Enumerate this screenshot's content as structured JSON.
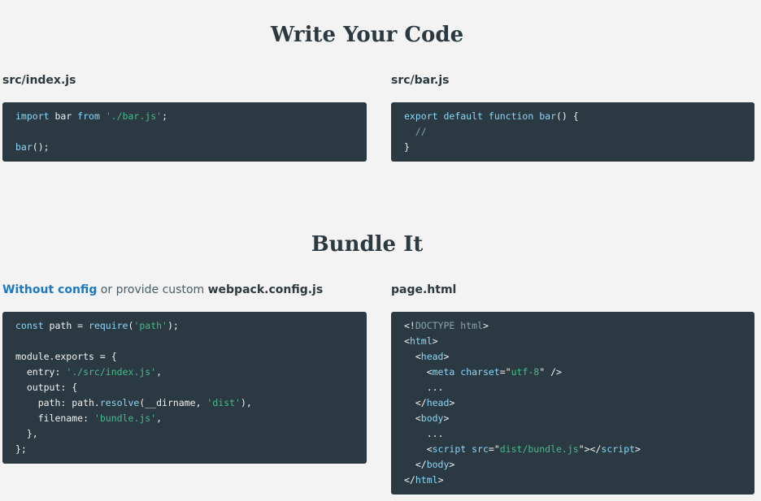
{
  "sections": {
    "write": {
      "title": "Write Your Code",
      "index_file": {
        "label": "src/index.js",
        "lines": [
          [
            {
              "t": "kw",
              "v": "import"
            },
            {
              "t": "p",
              "v": " bar "
            },
            {
              "t": "kw",
              "v": "from"
            },
            {
              "t": "p",
              "v": " "
            },
            {
              "t": "str",
              "v": "'./bar.js'"
            },
            {
              "t": "p",
              "v": ";"
            }
          ],
          [],
          [
            {
              "t": "fn",
              "v": "bar"
            },
            {
              "t": "p",
              "v": "();"
            }
          ]
        ]
      },
      "bar_file": {
        "label": "src/bar.js",
        "lines": [
          [
            {
              "t": "kw",
              "v": "export"
            },
            {
              "t": "p",
              "v": " "
            },
            {
              "t": "kw",
              "v": "default"
            },
            {
              "t": "p",
              "v": " "
            },
            {
              "t": "kw",
              "v": "function"
            },
            {
              "t": "p",
              "v": " "
            },
            {
              "t": "fn",
              "v": "bar"
            },
            {
              "t": "p",
              "v": "() {"
            }
          ],
          [
            {
              "t": "p",
              "v": "  "
            },
            {
              "t": "cm",
              "v": "//"
            }
          ],
          [
            {
              "t": "p",
              "v": "}"
            }
          ]
        ]
      }
    },
    "bundle": {
      "title": "Bundle It",
      "config": {
        "link_label": "Without config",
        "middle_text": " or provide custom ",
        "file_name": "webpack.config.js",
        "lines": [
          [
            {
              "t": "kw",
              "v": "const"
            },
            {
              "t": "p",
              "v": " path = "
            },
            {
              "t": "fn",
              "v": "require"
            },
            {
              "t": "p",
              "v": "("
            },
            {
              "t": "str",
              "v": "'path'"
            },
            {
              "t": "p",
              "v": ");"
            }
          ],
          [],
          [
            {
              "t": "p",
              "v": "module.exports = {"
            }
          ],
          [
            {
              "t": "p",
              "v": "  entry: "
            },
            {
              "t": "str",
              "v": "'./src/index.js'"
            },
            {
              "t": "p",
              "v": ","
            }
          ],
          [
            {
              "t": "p",
              "v": "  output: {"
            }
          ],
          [
            {
              "t": "p",
              "v": "    path: path."
            },
            {
              "t": "fn",
              "v": "resolve"
            },
            {
              "t": "p",
              "v": "(__dirname, "
            },
            {
              "t": "str",
              "v": "'dist'"
            },
            {
              "t": "p",
              "v": "),"
            }
          ],
          [
            {
              "t": "p",
              "v": "    filename: "
            },
            {
              "t": "str",
              "v": "'bundle.js'"
            },
            {
              "t": "p",
              "v": ","
            }
          ],
          [
            {
              "t": "p",
              "v": "  },"
            }
          ],
          [
            {
              "t": "p",
              "v": "};"
            }
          ]
        ]
      },
      "page": {
        "label": "page.html",
        "lines": [
          [
            {
              "t": "p",
              "v": "<!"
            },
            {
              "t": "cm",
              "v": "DOCTYPE html"
            },
            {
              "t": "p",
              "v": ">"
            }
          ],
          [
            {
              "t": "p",
              "v": "<"
            },
            {
              "t": "tag",
              "v": "html"
            },
            {
              "t": "p",
              "v": ">"
            }
          ],
          [
            {
              "t": "p",
              "v": "  <"
            },
            {
              "t": "tag",
              "v": "head"
            },
            {
              "t": "p",
              "v": ">"
            }
          ],
          [
            {
              "t": "p",
              "v": "    <"
            },
            {
              "t": "tag",
              "v": "meta"
            },
            {
              "t": "p",
              "v": " "
            },
            {
              "t": "attr",
              "v": "charset"
            },
            {
              "t": "p",
              "v": "=\""
            },
            {
              "t": "str",
              "v": "utf-8"
            },
            {
              "t": "p",
              "v": "\" />"
            }
          ],
          [
            {
              "t": "p",
              "v": "    ..."
            }
          ],
          [
            {
              "t": "p",
              "v": "  </"
            },
            {
              "t": "tag",
              "v": "head"
            },
            {
              "t": "p",
              "v": ">"
            }
          ],
          [
            {
              "t": "p",
              "v": "  <"
            },
            {
              "t": "tag",
              "v": "body"
            },
            {
              "t": "p",
              "v": ">"
            }
          ],
          [
            {
              "t": "p",
              "v": "    ..."
            }
          ],
          [
            {
              "t": "p",
              "v": "    <"
            },
            {
              "t": "tag",
              "v": "script"
            },
            {
              "t": "p",
              "v": " "
            },
            {
              "t": "attr",
              "v": "src"
            },
            {
              "t": "p",
              "v": "=\""
            },
            {
              "t": "str",
              "v": "dist/bundle.js"
            },
            {
              "t": "p",
              "v": "\"></"
            },
            {
              "t": "tag",
              "v": "script"
            },
            {
              "t": "p",
              "v": ">"
            }
          ],
          [
            {
              "t": "p",
              "v": "  </"
            },
            {
              "t": "tag",
              "v": "body"
            },
            {
              "t": "p",
              "v": ">"
            }
          ],
          [
            {
              "t": "p",
              "v": "</"
            },
            {
              "t": "tag",
              "v": "html"
            },
            {
              "t": "p",
              "v": ">"
            }
          ]
        ]
      }
    }
  },
  "colors": {
    "background": "#f3f3f3",
    "code_background": "#2b3a42",
    "heading": "#2b3a42",
    "link": "#1d78c1",
    "keyword": "#8dd6f9",
    "string": "#48b98a",
    "comment": "#8aa3ad"
  }
}
